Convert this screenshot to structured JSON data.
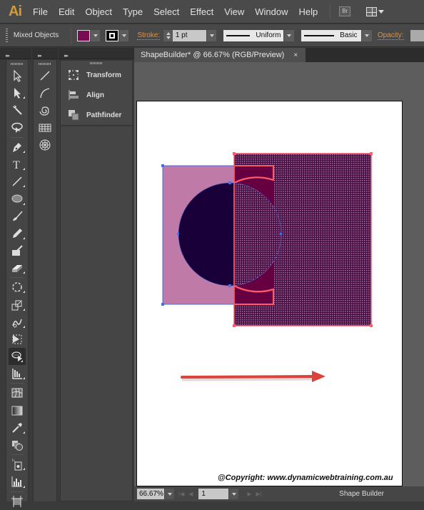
{
  "app": {
    "logo": "Ai"
  },
  "menu": [
    "File",
    "Edit",
    "Object",
    "Type",
    "Select",
    "Effect",
    "View",
    "Window",
    "Help"
  ],
  "bridge_label": "Br",
  "control_bar": {
    "selection_label": "Mixed Objects",
    "fill_color": "#7a0a52",
    "stroke_label": "Stroke:",
    "stroke_weight": "1 pt",
    "variable_width_profile": "Uniform",
    "brush_definition": "Basic",
    "opacity_label": "Opacity:"
  },
  "panels": {
    "dock_items": [
      {
        "label": "Transform",
        "icon": "transform-icon"
      },
      {
        "label": "Align",
        "icon": "align-icon"
      },
      {
        "label": "Pathfinder",
        "icon": "pathfinder-icon"
      }
    ]
  },
  "tools": {
    "main": [
      "selection",
      "direct-selection",
      "magic-wand",
      "lasso",
      "pen",
      "type",
      "line-segment",
      "ellipse",
      "paintbrush",
      "pencil",
      "blob-brush",
      "eraser",
      "rotate",
      "scale",
      "warp",
      "free-transform",
      "shape-builder",
      "perspective-grid",
      "mesh",
      "gradient",
      "eyedropper",
      "blend",
      "symbol-sprayer",
      "column-graph",
      "artboard"
    ],
    "flyout": [
      "line-segment",
      "arc",
      "spiral",
      "rectangular-grid",
      "polar-grid"
    ],
    "active": "shape-builder"
  },
  "document": {
    "tab_title": "ShapeBuilder* @ 66.67% (RGB/Preview)",
    "close_glyph": "×",
    "copyright": "@Copyright: www.dynamicwebtraining.com.au"
  },
  "colors": {
    "left_rect": "#c07aa8",
    "circle": "#1a0038",
    "overlap": "#660040",
    "big_rect": "#4a1a50",
    "highlight_stroke": "#ff5a6a",
    "selection_blue": "#4a6ee0",
    "arrow": "#d9443c"
  },
  "status_bar": {
    "zoom": "66.67%",
    "page": "1",
    "current_tool": "Shape Builder"
  }
}
